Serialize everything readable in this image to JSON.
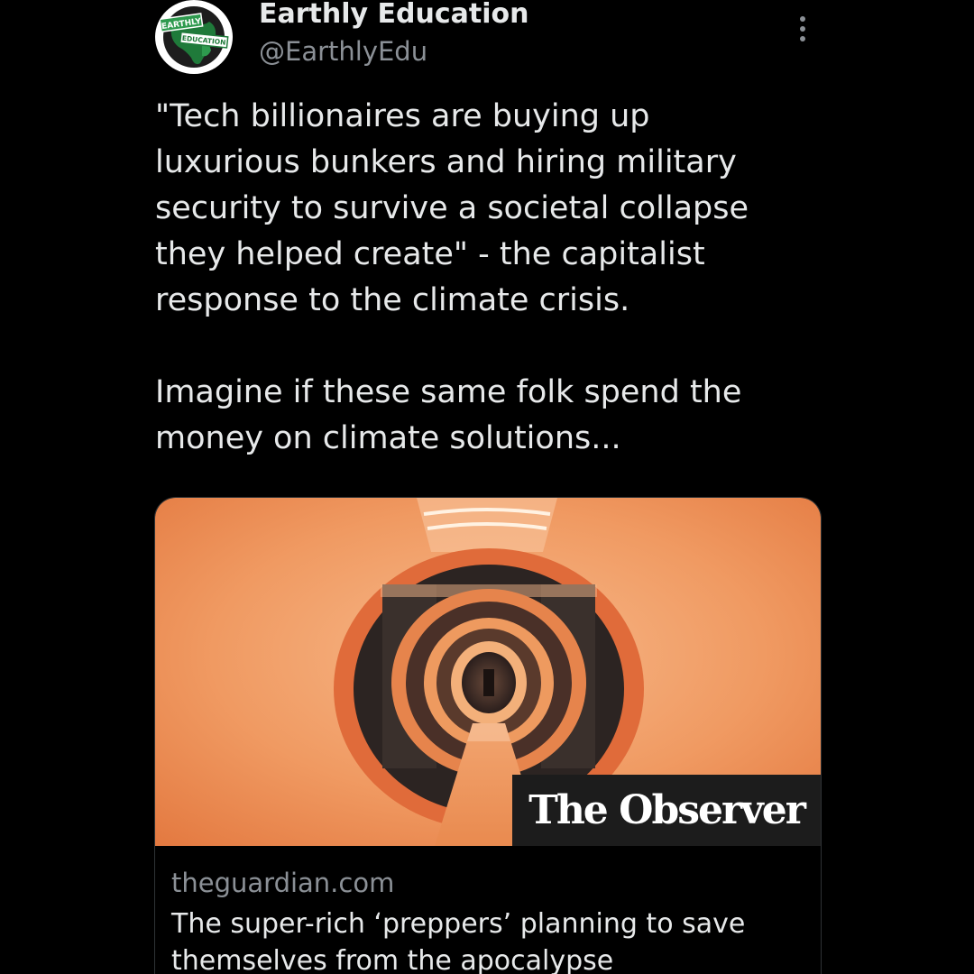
{
  "tweet": {
    "display_name": "Earthly Education",
    "handle": "@EarthlyEdu",
    "avatar_badge_top": "EARTHLY",
    "avatar_badge_bottom": "EDUCATION",
    "text": "\"Tech billionaires are buying up luxurious bunkers and hiring military security to survive a societal collapse they helped create\" - the capitalist response to the climate crisis.\n\nImagine if these same folk spend the money on climate solutions...",
    "more_icon": "more-vertical-icon"
  },
  "link_card": {
    "domain": "theguardian.com",
    "title": "The super-rich ‘preppers’ planning to save themselves from the apocalypse",
    "source_badge": "The Observer",
    "image_description_icon": "bunker-tunnel-image"
  },
  "colors": {
    "background": "#000000",
    "text_primary": "#e7e9ea",
    "text_secondary": "#8b9096",
    "tunnel_orange": "#f0a070"
  }
}
